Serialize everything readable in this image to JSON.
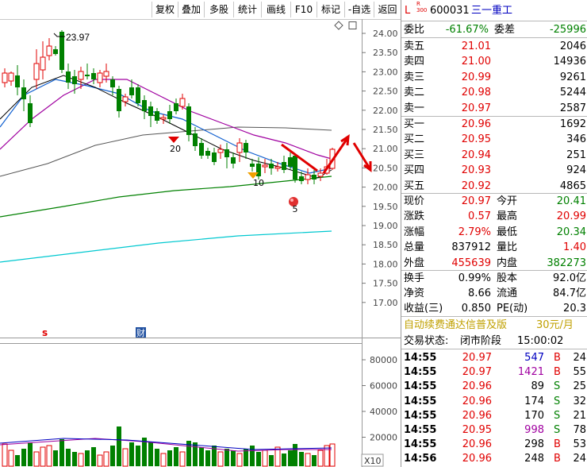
{
  "toolbar": {
    "buttons": [
      "复权",
      "叠加",
      "多股",
      "统计",
      "画线",
      "F10",
      "标记",
      "-自选",
      "返回"
    ]
  },
  "chart": {
    "price_axis": [
      "24.00",
      "23.50",
      "23.00",
      "22.50",
      "22.00",
      "21.50",
      "21.00",
      "20.50",
      "20.00",
      "19.50",
      "19.00",
      "18.50",
      "18.00",
      "17.50",
      "17.00"
    ],
    "volume_axis": [
      "80000",
      "60000",
      "40000",
      "20000"
    ],
    "volume_unit": "X10",
    "high_label": "23.97",
    "markers": [
      "20",
      "10",
      "5"
    ],
    "event_label_1": "s",
    "event_label_2": "财"
  },
  "stock": {
    "market_badge_top": "L",
    "market_badge_sub": "R\n300",
    "code": "600031",
    "name": "三一重工"
  },
  "order_ratio": {
    "label": "委比",
    "value": "-61.67%",
    "diff_label": "委差",
    "diff_value": "-25996"
  },
  "asks": [
    {
      "label": "卖五",
      "price": "21.01",
      "vol": "2046"
    },
    {
      "label": "卖四",
      "price": "21.00",
      "vol": "14936"
    },
    {
      "label": "卖三",
      "price": "20.99",
      "vol": "9261"
    },
    {
      "label": "卖二",
      "price": "20.98",
      "vol": "5244"
    },
    {
      "label": "卖一",
      "price": "20.97",
      "vol": "2587"
    }
  ],
  "bids": [
    {
      "label": "买一",
      "price": "20.96",
      "vol": "1692"
    },
    {
      "label": "买二",
      "price": "20.95",
      "vol": "346"
    },
    {
      "label": "买三",
      "price": "20.94",
      "vol": "251"
    },
    {
      "label": "买四",
      "price": "20.93",
      "vol": "924"
    },
    {
      "label": "买五",
      "price": "20.92",
      "vol": "4865"
    }
  ],
  "quote": [
    {
      "l1": "现价",
      "v1": "20.97",
      "c1": "red",
      "l2": "今开",
      "v2": "20.41",
      "c2": "grn"
    },
    {
      "l1": "涨跌",
      "v1": "0.57",
      "c1": "red",
      "l2": "最高",
      "v2": "20.99",
      "c2": "red"
    },
    {
      "l1": "涨幅",
      "v1": "2.79%",
      "c1": "red",
      "l2": "最低",
      "v2": "20.34",
      "c2": "grn"
    },
    {
      "l1": "总量",
      "v1": "837912",
      "c1": "blk",
      "l2": "量比",
      "v2": "1.40",
      "c2": "red"
    },
    {
      "l1": "外盘",
      "v1": "455639",
      "c1": "red",
      "l2": "内盘",
      "v2": "382273",
      "c2": "grn"
    }
  ],
  "fundamentals": [
    {
      "l1": "换手",
      "v1": "0.99%",
      "l2": "股本",
      "v2": "92.0亿"
    },
    {
      "l1": "净资",
      "v1": "8.66",
      "l2": "流通",
      "v2": "84.7亿"
    },
    {
      "l1": "收益(三)",
      "v1": "0.850",
      "l2": "PE(动)",
      "v2": "20.3"
    }
  ],
  "promo": {
    "text": "自动续费通达信普及版",
    "price": "30元/月"
  },
  "trade_status": {
    "label": "交易状态:",
    "value": "闭市阶段",
    "time": "15:00:02"
  },
  "ticks": [
    {
      "time": "14:55",
      "price": "20.97",
      "vol": "547",
      "side": "B",
      "n": "24",
      "vc": "blu"
    },
    {
      "time": "14:55",
      "price": "20.97",
      "vol": "1421",
      "side": "B",
      "n": "55",
      "vc": "pur"
    },
    {
      "time": "14:55",
      "price": "20.96",
      "vol": "89",
      "side": "S",
      "n": "25",
      "vc": "blk"
    },
    {
      "time": "14:55",
      "price": "20.96",
      "vol": "174",
      "side": "S",
      "n": "32",
      "vc": "blk"
    },
    {
      "time": "14:55",
      "price": "20.96",
      "vol": "170",
      "side": "S",
      "n": "21",
      "vc": "blk"
    },
    {
      "time": "14:55",
      "price": "20.95",
      "vol": "998",
      "side": "S",
      "n": "78",
      "vc": "pur"
    },
    {
      "time": "14:55",
      "price": "20.96",
      "vol": "298",
      "side": "B",
      "n": "53",
      "vc": "blk"
    },
    {
      "time": "14:56",
      "price": "20.96",
      "vol": "248",
      "side": "B",
      "n": "24",
      "vc": "blk"
    }
  ]
}
